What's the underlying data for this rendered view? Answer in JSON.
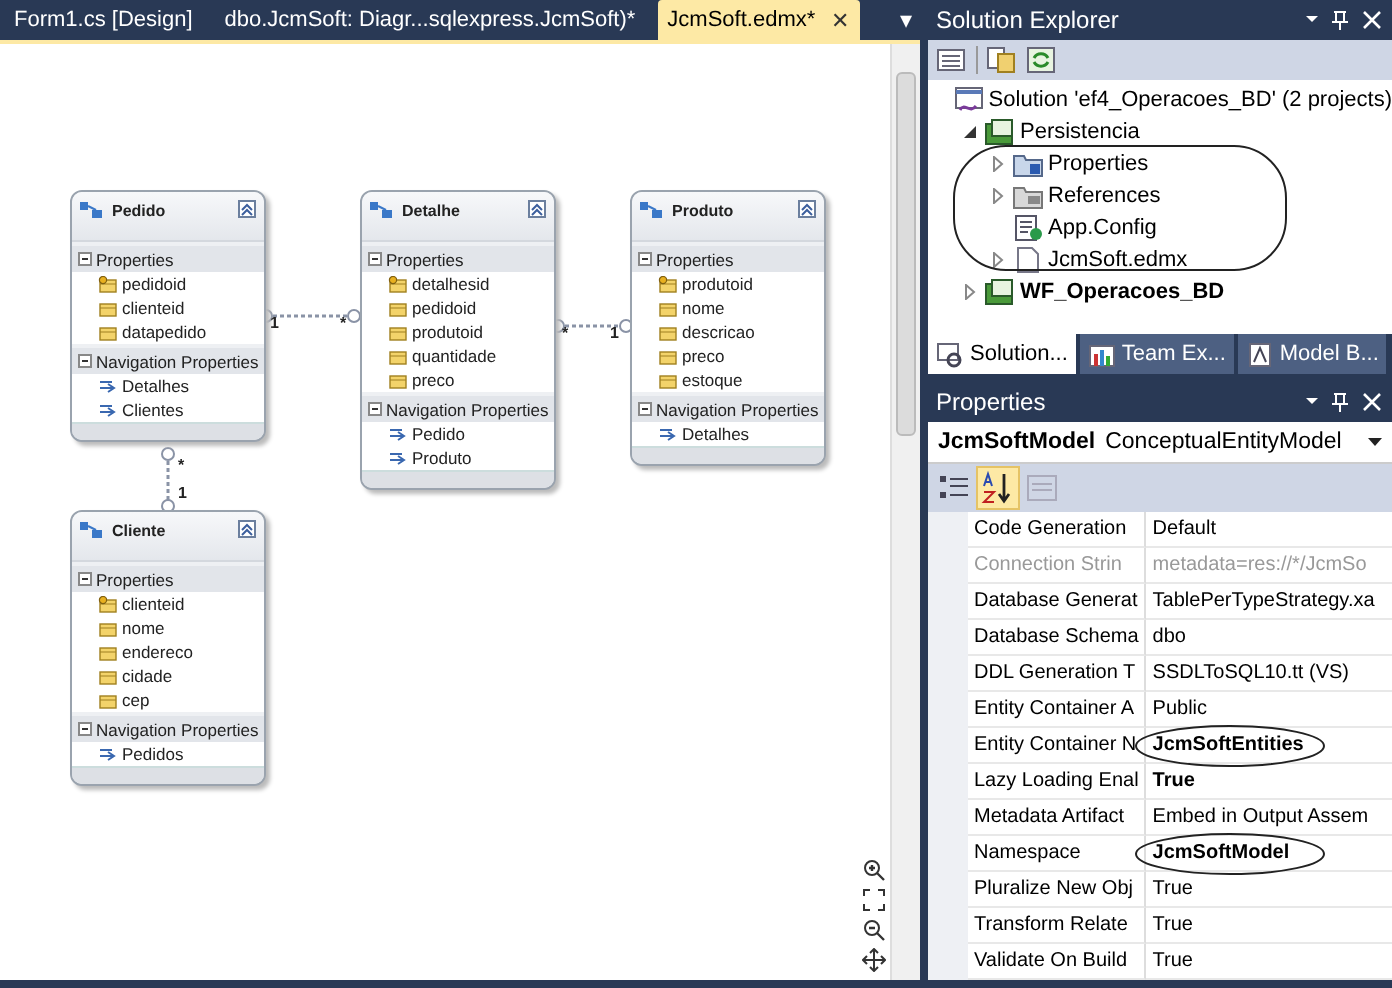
{
  "document_tabs": [
    {
      "label": "Form1.cs [Design]",
      "selected": false
    },
    {
      "label": "dbo.JcmSoft: Diagr...sqlexpress.JcmSoft)*",
      "selected": false
    },
    {
      "label": "JcmSoft.edmx*",
      "selected": true,
      "close": "✕"
    }
  ],
  "tab_overflow": "▾",
  "diagram": {
    "entities": [
      {
        "name": "Pedido",
        "properties_header": "Properties",
        "properties": [
          {
            "name": "pedidoid",
            "key": true
          },
          {
            "name": "clienteid",
            "key": false
          },
          {
            "name": "datapedido",
            "key": false
          }
        ],
        "navigation_header": "Navigation Properties",
        "navigation": [
          "Detalhes",
          "Clientes"
        ]
      },
      {
        "name": "Detalhe",
        "properties_header": "Properties",
        "properties": [
          {
            "name": "detalhesid",
            "key": true
          },
          {
            "name": "pedidoid",
            "key": false
          },
          {
            "name": "produtoid",
            "key": false
          },
          {
            "name": "quantidade",
            "key": false
          },
          {
            "name": "preco",
            "key": false
          }
        ],
        "navigation_header": "Navigation Properties",
        "navigation": [
          "Pedido",
          "Produto"
        ]
      },
      {
        "name": "Produto",
        "properties_header": "Properties",
        "properties": [
          {
            "name": "produtoid",
            "key": true
          },
          {
            "name": "nome",
            "key": false
          },
          {
            "name": "descricao",
            "key": false
          },
          {
            "name": "preco",
            "key": false
          },
          {
            "name": "estoque",
            "key": false
          }
        ],
        "navigation_header": "Navigation Properties",
        "navigation": [
          "Detalhes"
        ]
      },
      {
        "name": "Cliente",
        "properties_header": "Properties",
        "properties": [
          {
            "name": "clienteid",
            "key": true
          },
          {
            "name": "nome",
            "key": false
          },
          {
            "name": "endereco",
            "key": false
          },
          {
            "name": "cidade",
            "key": false
          },
          {
            "name": "cep",
            "key": false
          }
        ],
        "navigation_header": "Navigation Properties",
        "navigation": [
          "Pedidos"
        ]
      }
    ],
    "associations": [
      {
        "start_multiplicity": "1",
        "end_multiplicity": "*"
      },
      {
        "start_multiplicity": "*",
        "end_multiplicity": "1"
      },
      {
        "start_multiplicity": "*",
        "end_multiplicity": "1"
      }
    ]
  },
  "solution_explorer": {
    "title": "Solution Explorer",
    "tree": [
      {
        "label": "Solution 'ef4_Operacoes_BD' (2 projects)",
        "kind": "solution",
        "bold": false,
        "expandable": false,
        "expanded": true,
        "circle_children": false,
        "children": [
          {
            "label": "Persistencia",
            "kind": "project",
            "bold": false,
            "expandable": true,
            "expanded": true,
            "circle_children": true,
            "children": [
              {
                "label": "Properties",
                "kind": "properties",
                "bold": false,
                "expandable": true,
                "expanded": false,
                "circle_children": false
              },
              {
                "label": "References",
                "kind": "references",
                "bold": false,
                "expandable": true,
                "expanded": false,
                "circle_children": false
              },
              {
                "label": "App.Config",
                "kind": "config",
                "bold": false,
                "expandable": false,
                "circle_children": false
              },
              {
                "label": "JcmSoft.edmx",
                "kind": "file",
                "bold": false,
                "expandable": true,
                "expanded": false,
                "circle_children": false
              }
            ]
          },
          {
            "label": "WF_Operacoes_BD",
            "kind": "project",
            "bold": true,
            "expandable": true,
            "expanded": false,
            "circle_children": false
          }
        ]
      }
    ],
    "tabs": [
      {
        "label": "Solution...",
        "kind": "solution",
        "selected": true
      },
      {
        "label": "Team Ex...",
        "kind": "team",
        "selected": false
      },
      {
        "label": "Model B...",
        "kind": "model",
        "selected": false
      }
    ]
  },
  "properties": {
    "title": "Properties",
    "object_name": "JcmSoftModel",
    "object_type": "ConceptualEntityModel",
    "alphabetical": true,
    "rows": [
      {
        "name": "Code Generation",
        "value": "Default",
        "bold": false,
        "disabled": false,
        "circled": false
      },
      {
        "name": "Connection Strin",
        "value": "metadata=res://*/JcmSo",
        "bold": false,
        "disabled": true,
        "circled": false
      },
      {
        "name": "Database Generat",
        "value": "TablePerTypeStrategy.xa",
        "bold": false,
        "disabled": false,
        "circled": false
      },
      {
        "name": "Database Schema",
        "value": "dbo",
        "bold": false,
        "disabled": false,
        "circled": false
      },
      {
        "name": "DDL Generation T",
        "value": "SSDLToSQL10.tt (VS)",
        "bold": false,
        "disabled": false,
        "circled": false
      },
      {
        "name": "Entity Container A",
        "value": "Public",
        "bold": false,
        "disabled": false,
        "circled": false
      },
      {
        "name": "Entity Container N",
        "value": "JcmSoftEntities",
        "bold": true,
        "disabled": false,
        "circled": true
      },
      {
        "name": "Lazy Loading Enal",
        "value": "True",
        "bold": true,
        "disabled": false,
        "circled": false
      },
      {
        "name": "Metadata Artifact",
        "value": "Embed in Output Assem",
        "bold": false,
        "disabled": false,
        "circled": false
      },
      {
        "name": "Namespace",
        "value": "JcmSoftModel",
        "bold": true,
        "disabled": false,
        "circled": true
      },
      {
        "name": "Pluralize New Obj",
        "value": "True",
        "bold": false,
        "disabled": false,
        "circled": false
      },
      {
        "name": "Transform Relate",
        "value": "True",
        "bold": false,
        "disabled": false,
        "circled": false
      },
      {
        "name": "Validate On Build",
        "value": "True",
        "bold": false,
        "disabled": false,
        "circled": false
      }
    ]
  }
}
